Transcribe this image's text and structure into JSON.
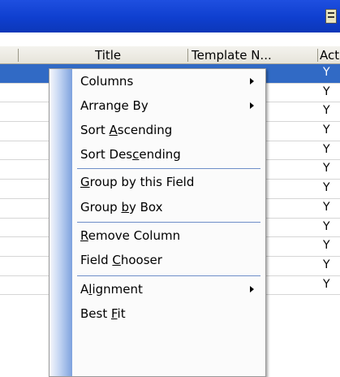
{
  "grid": {
    "columns": [
      {
        "label": "Title"
      },
      {
        "label": "Template N..."
      },
      {
        "label": "Active"
      }
    ],
    "rows": [
      {
        "active": "Y",
        "selected": true
      },
      {
        "active": "Y"
      },
      {
        "active": "Y"
      },
      {
        "active": "Y"
      },
      {
        "active": "Y"
      },
      {
        "active": "Y"
      },
      {
        "active": "Y"
      },
      {
        "active": "Y"
      },
      {
        "active": "Y"
      },
      {
        "active": "Y"
      },
      {
        "active": "Y"
      },
      {
        "active": "Y"
      }
    ]
  },
  "menu": {
    "columns": "Columns",
    "arrange_pre": "Arrange By",
    "sort_asc_pre": "Sort ",
    "sort_asc_key": "A",
    "sort_asc_post": "scending",
    "sort_desc_pre": "Sort Des",
    "sort_desc_key": "c",
    "sort_desc_post": "ending",
    "group_field_key": "G",
    "group_field_post": "roup by this Field",
    "group_box_pre": "Group ",
    "group_box_key": "b",
    "group_box_post": "y Box",
    "remove_key": "R",
    "remove_post": "emove Column",
    "chooser_pre": "Field ",
    "chooser_key": "C",
    "chooser_post": "hooser",
    "align_pre": "A",
    "align_key": "l",
    "align_post": "ignment",
    "bestfit_pre": "Best ",
    "bestfit_key": "F",
    "bestfit_post": "it"
  }
}
